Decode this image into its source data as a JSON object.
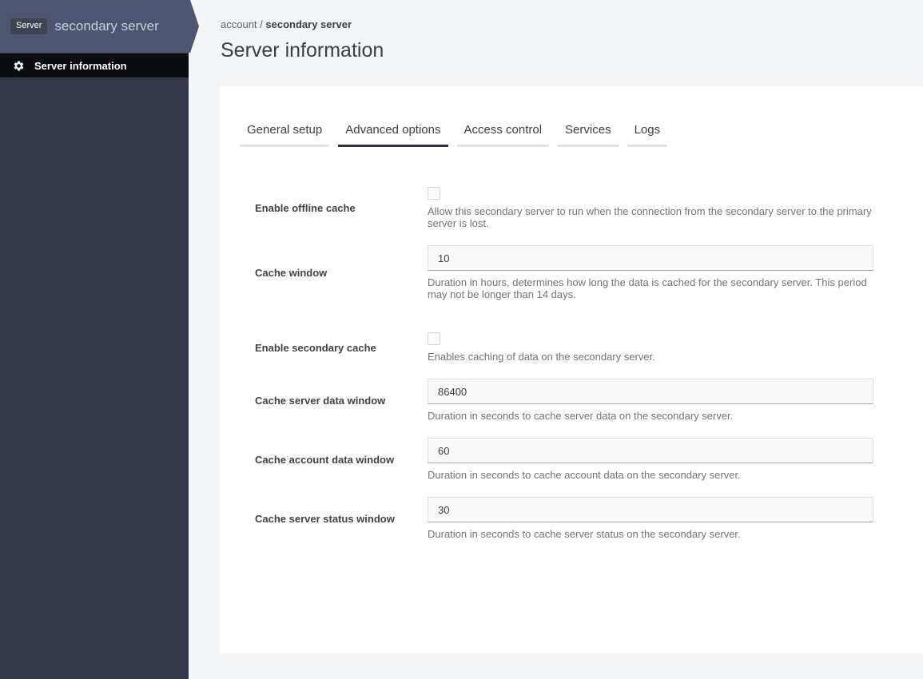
{
  "colors": {
    "ribbon": "#4d5571",
    "badge_bg": "#3e4452",
    "sidebar_bg": "#323848",
    "nav_bar_bg": "#0a0c10",
    "page_bg": "#f4f5f7",
    "card_bg": "#ffffff",
    "active_tab_underline": "#2b3245"
  },
  "sidebar": {
    "badge": "Server",
    "title": "secondary server",
    "items": [
      {
        "label": "Server information",
        "icon": "gear-icon"
      }
    ]
  },
  "breadcrumb": {
    "account": "account",
    "separator": " / ",
    "current": "secondary server"
  },
  "page": {
    "title": "Server information"
  },
  "tabs": [
    {
      "label": "General setup",
      "active": false
    },
    {
      "label": "Advanced options",
      "active": true
    },
    {
      "label": "Access control",
      "active": false
    },
    {
      "label": "Services",
      "active": false
    },
    {
      "label": "Logs",
      "active": false
    }
  ],
  "form": {
    "fields": [
      {
        "label": "Enable offline cache",
        "type": "checkbox",
        "checked": false,
        "help": "Allow this secondary server to run when the connection from the secondary server to the primary server is lost."
      },
      {
        "label": "Cache window",
        "type": "text",
        "value": "10",
        "help": "Duration in hours, determines how long the data is cached for the secondary server. This period may not be longer than 14 days."
      },
      {
        "label": "Enable secondary cache",
        "type": "checkbox",
        "checked": false,
        "help": "Enables caching of data on the secondary server."
      },
      {
        "label": "Cache server data window",
        "type": "text",
        "value": "86400",
        "help": "Duration in seconds to cache server data on the secondary server."
      },
      {
        "label": "Cache account data window",
        "type": "text",
        "value": "60",
        "help": "Duration in seconds to cache account data on the secondary server."
      },
      {
        "label": "Cache server status window",
        "type": "text",
        "value": "30",
        "help": "Duration in seconds to cache server status on the secondary server."
      }
    ]
  }
}
